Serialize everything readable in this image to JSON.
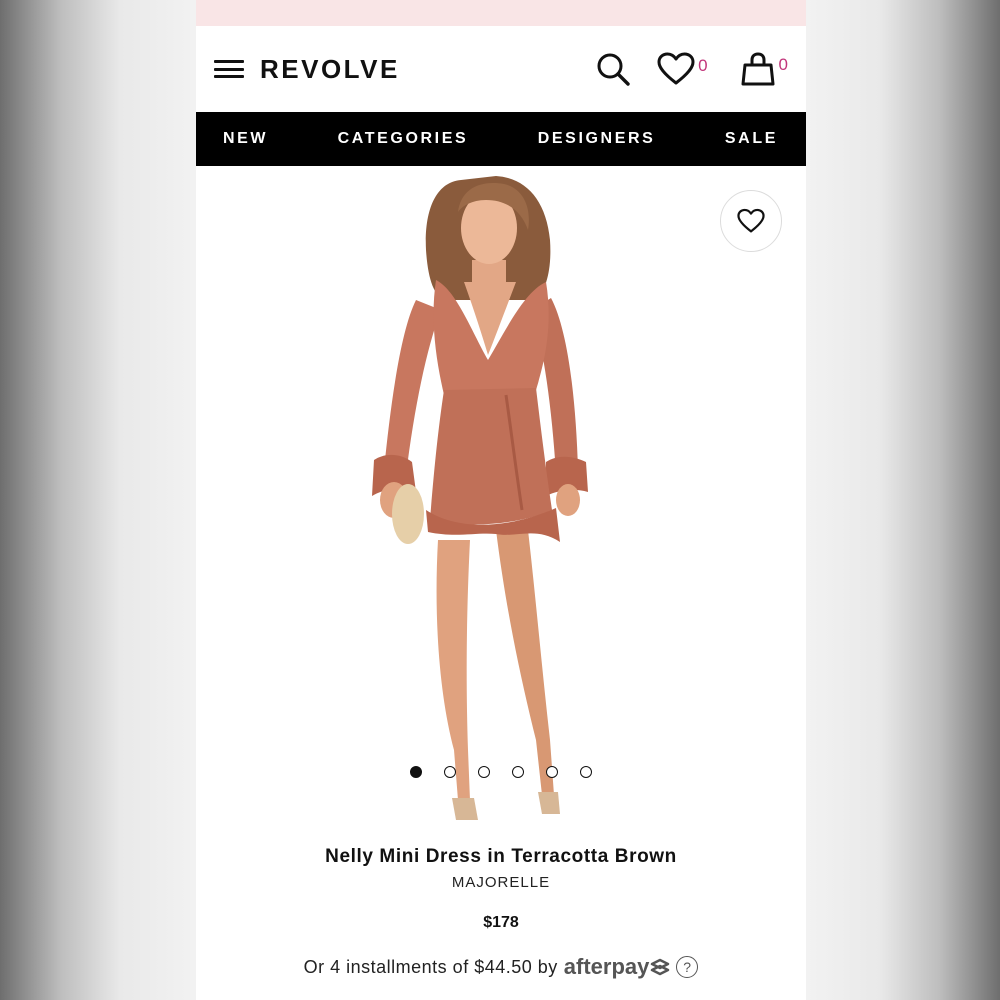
{
  "header": {
    "logo": "REVOLVE",
    "wishlist_count": "0",
    "bag_count": "0"
  },
  "nav": {
    "items": [
      "NEW",
      "CATEGORIES",
      "DESIGNERS",
      "SALE"
    ]
  },
  "product": {
    "title": "Nelly Mini Dress in Terracotta Brown",
    "brand": "MAJORELLE",
    "price": "$178",
    "image_count": 6,
    "active_image_index": 0
  },
  "payment": {
    "text": "Or 4 installments of $44.50 by",
    "provider": "afterpay",
    "help": "?"
  },
  "colors": {
    "accent": "#c2367b",
    "nav_bg": "#000000",
    "promo_strip": "#f9e5e6",
    "dress": "#c8775f"
  },
  "icons": [
    "menu-icon",
    "search-icon",
    "heart-icon",
    "bag-icon",
    "heart-outline-icon",
    "afterpay-arrows-icon"
  ]
}
